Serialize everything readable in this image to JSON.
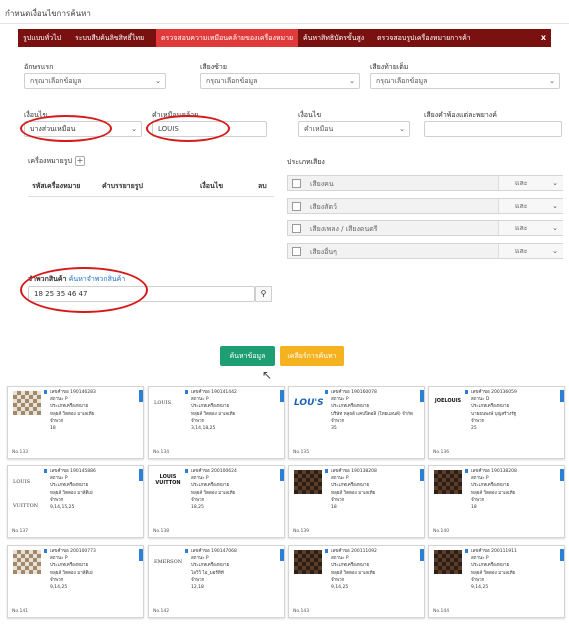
{
  "header": {
    "title": "กำหนดเงื่อนไขการค้นหา"
  },
  "tabs": [
    {
      "label": "รูปแบบทั่วไป",
      "active": false
    },
    {
      "label": "ระบบสืบค้นลิขสิทธิ์ไทย",
      "active": false
    },
    {
      "label": "ตรวจสอบความเหมือนคล้ายของเครื่องหมาย",
      "active": true
    },
    {
      "label": "ค้นหาสิทธิบัตรขั้นสูง",
      "active": false
    },
    {
      "label": "ตรวจสอบรูปเครื่องหมายการค้า",
      "active": false
    }
  ],
  "close_label": "x",
  "filters": {
    "alphabet": {
      "label": "อักษรแรก",
      "value": "กรุณาเลือกข้อมูล"
    },
    "left_sound": {
      "label": "เสียงซ้าย",
      "value": "กรุณาเลือกข้อมูล"
    },
    "tail_sound": {
      "label": "เสียงท้ายเต็ม",
      "value": "กรุณาเลือกข้อมูล"
    },
    "condition1": {
      "label": "เงื่อนไข",
      "value": "บางส่วนเหมือน"
    },
    "similar_word": {
      "label": "คำเหมือนคล้าย",
      "value": "LOUIS"
    },
    "condition2": {
      "label": "เงื่อนไข",
      "value": "คำเหมือน"
    },
    "sound_dict": {
      "label": "เสียงคำพ้องแต่ละพยางค์",
      "value": ""
    }
  },
  "figure_marks": {
    "label": "เครื่องหมายรูป",
    "plus": "+",
    "columns": [
      "รหัสเครื่องหมาย",
      "คำบรรยายรูป",
      "เงื่อนไข",
      "ลบ"
    ]
  },
  "sound_types": {
    "label": "ประเภทเสียง",
    "rows": [
      {
        "label": "เสียงคน",
        "op": "และ"
      },
      {
        "label": "เสียงสัตว์",
        "op": "และ"
      },
      {
        "label": "เสียงเพลง / เสียงดนตรี",
        "op": "และ"
      },
      {
        "label": "เสียงอื่นๆ",
        "op": "และ"
      }
    ]
  },
  "goods": {
    "label": "จำพวกสินค้า",
    "link": "ค้นหาจำพวกสินค้า",
    "value": "18 25 35 46 47",
    "search_icon": "magnifier-icon"
  },
  "buttons": {
    "search": "ค้นหาข้อมูล",
    "cancel": "เคลียร์การค้นหา"
  },
  "results": [
    {
      "no": "No.133",
      "logo": "checker",
      "lines": [
        "เลขคำขอ 190146283",
        "สถานะ P",
        "ประเภทเครื่องหมาย",
        "หลุยส์ วิตตอง มาเลเทีย",
        "จำพวก",
        "18"
      ]
    },
    {
      "no": "No.134",
      "logo": "text",
      "logo_text": "LOUIS",
      "lines": [
        "เลขคำขอ 190141442",
        "สถานะ P",
        "ประเภทเครื่องหมาย",
        "หลุยส์ วิตตอง มาเลเทีย",
        "จำพวก",
        "3,14,18,25"
      ]
    },
    {
      "no": "No.135",
      "logo": "louis",
      "logo_text": "LOU'S",
      "lines": [
        "เลขคำขอ 190160078",
        "สถานะ P",
        "ประเภทเครื่องหมาย",
        "บริษัท หลุยส์ แคบปิตอลิ (ไทยแลนด์) จำกัด",
        "จำพวก",
        "35"
      ]
    },
    {
      "no": "No.136",
      "logo": "jlogo",
      "logo_text": "JOELOUIS",
      "lines": [
        "เลขคำขอ 200136059",
        "สถานะ D",
        "ประเภทเครื่องหมาย",
        "นายธนพงษ์ บุญสร้างรัฐ",
        "จำพวก",
        "25"
      ]
    },
    {
      "no": "No.137",
      "logo": "text",
      "logo_text": "LOUIS VUITTON",
      "lines": [
        "เลขคำขอ 190145886",
        "สถานะ P",
        "ประเภทเครื่องหมาย",
        "หลุยส์ วิตตอง มาลีติเย่",
        "จำพวก",
        "9,14,15,25"
      ]
    },
    {
      "no": "No.138",
      "logo": "vlogo",
      "logo_text": "LOUIS VUITTON",
      "lines": [
        "เลขคำขอ 200100624",
        "สถานะ P",
        "ประเภทเครื่องหมาย",
        "หลุยส์ วิตตอง มาเลเทีย",
        "จำพวก",
        "18,25"
      ]
    },
    {
      "no": "No.139",
      "logo": "dark",
      "lines": [
        "เลขคำขอ 190138208",
        "สถานะ P",
        "ประเภทเครื่องหมาย",
        "หลุยส์ วิตตอง มาเลเทีย",
        "จำพวก",
        "18"
      ]
    },
    {
      "no": "No.140",
      "logo": "dark",
      "lines": [
        "เลขคำขอ 190138208",
        "สถานะ P",
        "ประเภทเครื่องหมาย",
        "หลุยส์ วิตตอง มาเลเทีย",
        "จำพวก",
        "18"
      ]
    },
    {
      "no": "No.141",
      "logo": "checker",
      "lines": [
        "เลขคำขอ 200100773",
        "สถานะ P",
        "ประเภทเครื่องหมาย",
        "หลุยส์ วิตตอง มาลีติเย่",
        "จำพวก",
        "9,14,25"
      ]
    },
    {
      "no": "No.142",
      "logo": "text",
      "logo_text": "EMERSON",
      "lines": [
        "เลขคำขอ 190147068",
        "สถานะ P",
        "ประเภทเครื่องหมาย",
        "ไลวิวิ ไอ_มอร์ทิที",
        "จำพวก",
        "12,18"
      ]
    },
    {
      "no": "No.143",
      "logo": "dark",
      "lines": [
        "เลขคำขอ 200111092",
        "สถานะ P",
        "ประเภทเครื่องหมาย",
        "หลุยส์ วิตตอง มาเลเทีย",
        "จำพวก",
        "9,14,25"
      ]
    },
    {
      "no": "No.144",
      "logo": "dark",
      "lines": [
        "เลขคำขอ 200111911",
        "สถานะ P",
        "ประเภทเครื่องหมาย",
        "หลุยส์ วิตตอง มาเลเทีย",
        "จำพวก",
        "9,14,25"
      ]
    }
  ]
}
